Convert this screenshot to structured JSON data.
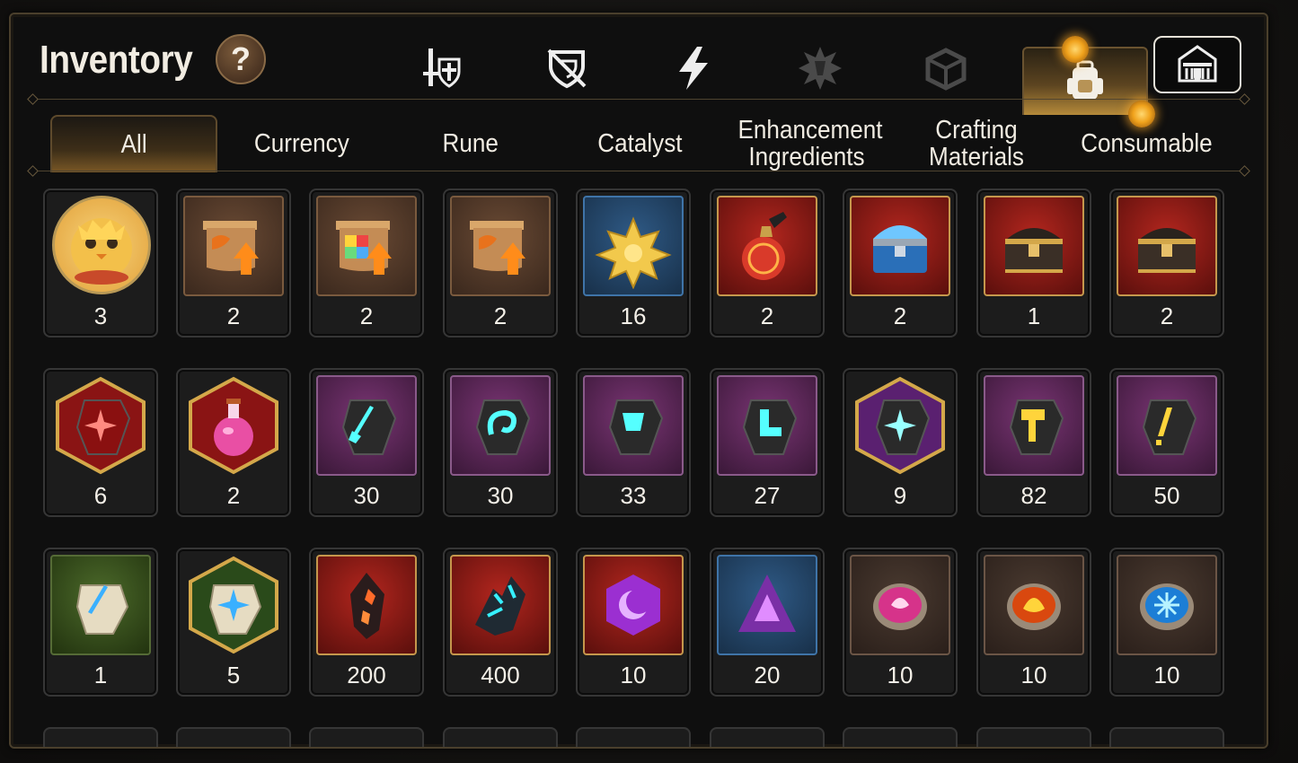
{
  "header": {
    "title": "Inventory",
    "help_label": "?"
  },
  "category_icons": [
    {
      "icon": "knight-sword-shield-icon",
      "active": false
    },
    {
      "icon": "crossed-shield-icon",
      "active": false
    },
    {
      "icon": "lightning-bolt-icon",
      "active": false
    },
    {
      "icon": "spiky-crest-icon",
      "active": false
    },
    {
      "icon": "cracked-cube-icon",
      "active": false
    },
    {
      "icon": "backpack-icon",
      "active": true,
      "notification": true
    },
    {
      "icon": "guild-castle-icon",
      "active": false
    }
  ],
  "tabs": [
    {
      "label": "All",
      "active": true
    },
    {
      "label": "Currency",
      "active": false
    },
    {
      "label": "Rune",
      "active": false
    },
    {
      "label": "Catalyst",
      "active": false
    },
    {
      "label": "Enhancement Ingredients",
      "active": false
    },
    {
      "label": "Crafting Materials",
      "active": false
    },
    {
      "label": "Consumable",
      "active": false,
      "notification": true
    }
  ],
  "items": [
    [
      {
        "icon": "chick-character-portrait-icon",
        "qty": "3"
      },
      {
        "icon": "orange-upgrade-scroll-icon",
        "qty": "2"
      },
      {
        "icon": "rainbow-cube-scroll-icon",
        "qty": "2"
      },
      {
        "icon": "orange-upgrade-scroll-icon",
        "qty": "2"
      },
      {
        "icon": "gold-lotus-crystal-icon",
        "qty": "16"
      },
      {
        "icon": "red-potion-vase-icon",
        "qty": "2"
      },
      {
        "icon": "blue-crystal-chest-icon",
        "qty": "2"
      },
      {
        "icon": "golden-treasure-chest-icon",
        "qty": "1"
      },
      {
        "icon": "golden-treasure-chest-icon",
        "qty": "2"
      }
    ],
    [
      {
        "icon": "red-star-rune-icon",
        "qty": "6"
      },
      {
        "icon": "pink-potion-flask-icon",
        "qty": "2"
      },
      {
        "icon": "sword-rune-stone-icon",
        "qty": "30"
      },
      {
        "icon": "spiral-rune-stone-icon",
        "qty": "30"
      },
      {
        "icon": "armor-rune-stone-icon",
        "qty": "33"
      },
      {
        "icon": "boot-rune-stone-icon",
        "qty": "27"
      },
      {
        "icon": "purple-star-rune-icon",
        "qty": "9"
      },
      {
        "icon": "hammer-rune-stone-icon",
        "qty": "82"
      },
      {
        "icon": "gold-slash-rune-stone-icon",
        "qty": "50"
      }
    ],
    [
      {
        "icon": "white-sword-stone-icon",
        "qty": "1"
      },
      {
        "icon": "white-star-stone-icon",
        "qty": "5"
      },
      {
        "icon": "magma-shard-icon",
        "qty": "200"
      },
      {
        "icon": "dark-crystal-cluster-icon",
        "qty": "400"
      },
      {
        "icon": "purple-moon-gem-icon",
        "qty": "10"
      },
      {
        "icon": "purple-triangle-gem-icon",
        "qty": "20"
      },
      {
        "icon": "magenta-orb-icon",
        "qty": "10"
      },
      {
        "icon": "fire-orb-icon",
        "qty": "10"
      },
      {
        "icon": "cyan-snowflake-orb-icon",
        "qty": "10"
      }
    ]
  ],
  "colors": {
    "gold_accent": "#c9a154",
    "panel_bg": "#0f0f0f",
    "slot_bg": "#1c1c1c",
    "text": "#f1ece2"
  }
}
